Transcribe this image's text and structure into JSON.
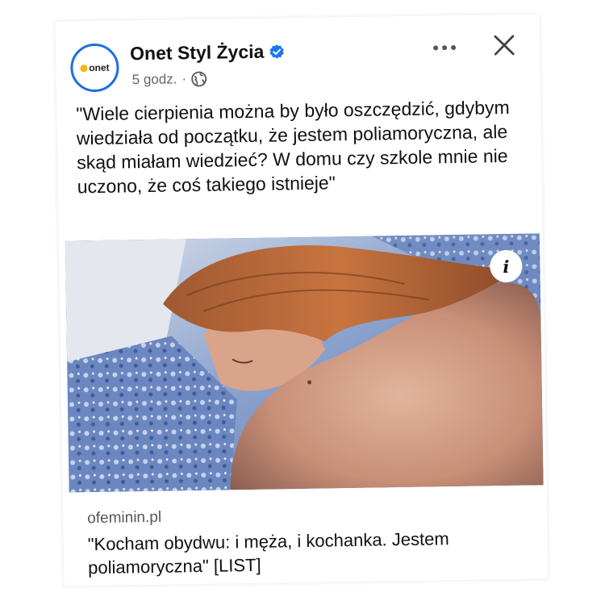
{
  "header": {
    "avatar_text": "onet",
    "page_name": "Onet Styl Życia",
    "time": "5 godz.",
    "separator": "·"
  },
  "icons": {
    "verified": "verified-badge-icon",
    "audience": "globe-icon",
    "more": "more-horizontal-icon",
    "close": "close-icon",
    "info": "info-icon"
  },
  "post": {
    "text": "\"Wiele cierpienia można by było oszczędzić, gdybym wiedziała od początku, że jestem poliamoryczna, ale skąd miałam wiedzieć? W domu czy szkole mnie nie uczono, że coś takiego istnieje\""
  },
  "image": {
    "info_label": "i"
  },
  "link": {
    "domain": "ofeminin.pl",
    "title": "\"Kocham obydwu: i męża, i kochanka. Jestem poliamoryczna\" [LIST]"
  },
  "colors": {
    "verified_blue": "#1877f2",
    "avatar_ring": "#1d6fe0",
    "onet_dot": "#f6b60f"
  }
}
